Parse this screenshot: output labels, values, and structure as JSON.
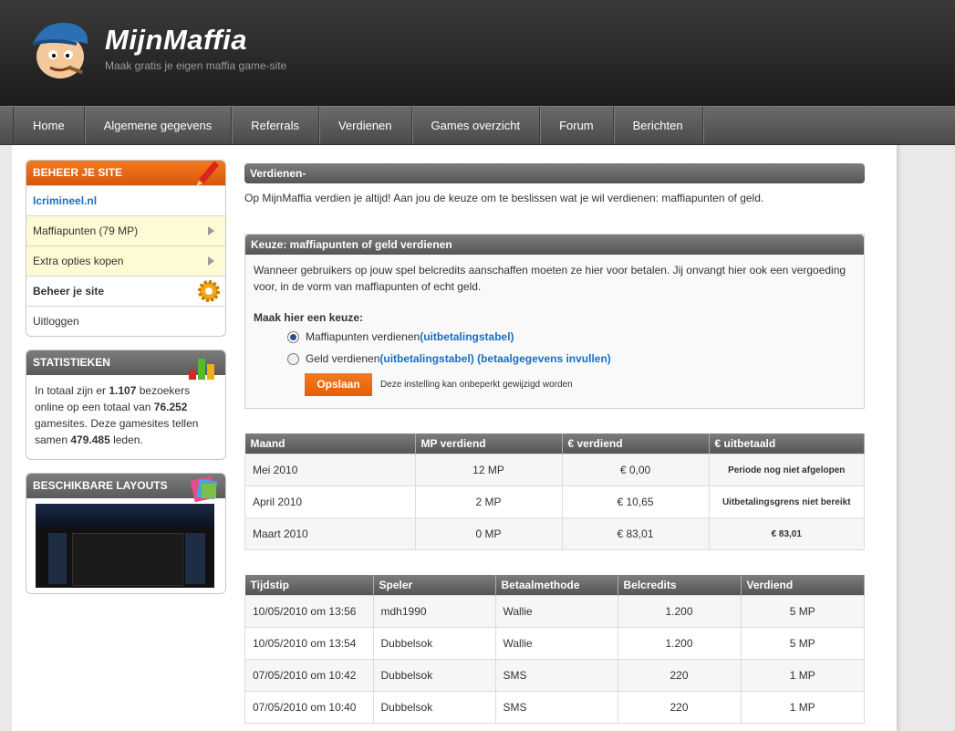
{
  "header": {
    "title": "MijnMaffia",
    "subtitle": "Maak gratis je eigen maffia game-site"
  },
  "nav": [
    "Home",
    "Algemene gegevens",
    "Referrals",
    "Verdienen",
    "Games overzicht",
    "Forum",
    "Berichten"
  ],
  "sidebar": {
    "manage": {
      "title": "BEHEER JE SITE",
      "site_link": "Icrimineel.nl",
      "items": [
        "Maffiapunten (79 MP)",
        "Extra opties kopen",
        "Beheer je site",
        "Uitloggen"
      ]
    },
    "stats": {
      "title": "STATISTIEKEN",
      "t1": "In totaal zijn er ",
      "visitors": "1.107",
      "t2": " bezoekers online op een totaal van ",
      "sites": "76.252",
      "t3": " gamesites. Deze gamesites tellen samen ",
      "members": "479.485",
      "t4": " leden."
    },
    "layouts": {
      "title": "BESCHIKBARE LAYOUTS"
    }
  },
  "main": {
    "title": "Verdienen-",
    "intro": "Op MijnMaffia verdien je altijd! Aan jou de keuze om te beslissen wat je wil verdienen: maffiapunten of geld.",
    "choice": {
      "title": "Keuze: maffiapunten of geld verdienen",
      "desc": "Wanneer gebruikers op jouw spel belcredits aanschaffen moeten ze hier voor betalen. Jij onvangt hier ook een vergoeding voor, in de vorm van maffiapunten of echt geld.",
      "prompt": "Maak hier een keuze:",
      "opt1": "Maffiapunten verdienen ",
      "opt1_link": "(uitbetalingstabel)",
      "opt2": "Geld verdienen ",
      "opt2_link1": "(uitbetalingstabel)",
      "opt2_link2": "(betaalgegevens invullen)",
      "save": "Opslaan",
      "note": "Deze instelling kan onbeperkt gewijzigd worden"
    },
    "months": {
      "headers": [
        "Maand",
        "MP verdiend",
        "€ verdiend",
        "€ uitbetaald"
      ],
      "rows": [
        [
          "Mei 2010",
          "12 MP",
          "€ 0,00",
          "Periode nog niet afgelopen"
        ],
        [
          "April 2010",
          "2 MP",
          "€ 10,65",
          "Uitbetalingsgrens niet bereikt"
        ],
        [
          "Maart 2010",
          "0 MP",
          "€ 83,01",
          "€ 83,01"
        ]
      ]
    },
    "payments": {
      "headers": [
        "Tijdstip",
        "Speler",
        "Betaalmethode",
        "Belcredits",
        "Verdiend"
      ],
      "rows": [
        [
          "10/05/2010 om 13:56",
          "mdh1990",
          "Wallie",
          "1.200",
          "5 MP"
        ],
        [
          "10/05/2010 om 13:54",
          "Dubbelsok",
          "Wallie",
          "1.200",
          "5 MP"
        ],
        [
          "07/05/2010 om 10:42",
          "Dubbelsok",
          "SMS",
          "220",
          "1 MP"
        ],
        [
          "07/05/2010 om 10:40",
          "Dubbelsok",
          "SMS",
          "220",
          "1 MP"
        ]
      ]
    }
  }
}
